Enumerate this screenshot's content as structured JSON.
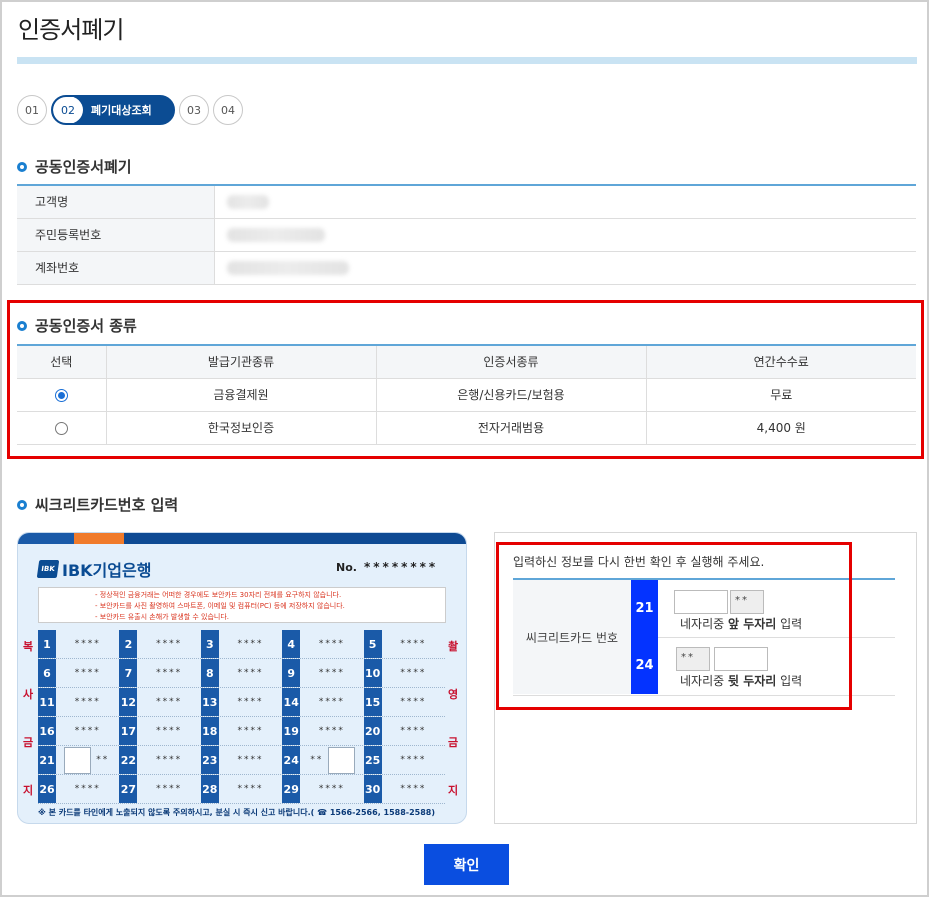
{
  "page_title": "인증서폐기",
  "steps": [
    {
      "num": "01"
    },
    {
      "num": "02",
      "label": "폐기대상조회"
    },
    {
      "num": "03"
    },
    {
      "num": "04"
    }
  ],
  "section1": {
    "title": "공동인증서폐기",
    "rows": [
      {
        "label": "고객명"
      },
      {
        "label": "주민등록번호"
      },
      {
        "label": "계좌번호"
      }
    ]
  },
  "section2": {
    "title": "공동인증서 종류",
    "headers": [
      "선택",
      "발급기관종류",
      "인증서종류",
      "연간수수료"
    ],
    "rows": [
      {
        "selected": true,
        "issuer": "금융결제원",
        "type": "은행/신용카드/보험용",
        "fee": "무료"
      },
      {
        "selected": false,
        "issuer": "한국정보인증",
        "type": "전자거래범용",
        "fee": "4,400 원"
      }
    ]
  },
  "section3": {
    "title": "씨크리트카드번호 입력"
  },
  "card": {
    "bank": "IBK기업은행",
    "logo_mark": "IBK",
    "no_label": "No.",
    "no_value": "********",
    "notices": [
      "- 정상적인 금융거래는 어떠한 경우에도 보안카드 30자리 전체를 요구하지 않습니다.",
      "- 보안카드를 사진 촬영하여 스마트폰, 이메일 및 컴퓨터(PC) 등에 저장하지 않습니다.",
      "- 보안카드 유출시 손해가 발생할 수 있습니다."
    ],
    "left_chars": [
      "복",
      "사",
      "금",
      "지"
    ],
    "right_chars": [
      "촬",
      "영",
      "금",
      "지"
    ],
    "mask": "****",
    "partial_mask": "**",
    "numbers": [
      [
        "1",
        "2",
        "3",
        "4",
        "5"
      ],
      [
        "6",
        "7",
        "8",
        "9",
        "10"
      ],
      [
        "11",
        "12",
        "13",
        "14",
        "15"
      ],
      [
        "16",
        "17",
        "18",
        "19",
        "20"
      ],
      [
        "21",
        "22",
        "23",
        "24",
        "25"
      ],
      [
        "26",
        "27",
        "28",
        "29",
        "30"
      ]
    ],
    "footer": "※ 본 카드를 타인에게 노출되지 않도록 주의하시고, 분실 시 즉시 신고 바랍니다.( ☎ 1566-2566, 1588-2588)"
  },
  "input_panel": {
    "message": "입력하신 정보를 다시 한번 확인 후 실행해 주세요.",
    "label": "씨크리트카드 번호",
    "row1": {
      "num": "21",
      "mask": "**",
      "desc_prefix": "네자리중 ",
      "desc_bold": "앞 두자리",
      "desc_suffix": " 입력"
    },
    "row2": {
      "num": "24",
      "mask": "**",
      "desc_prefix": "네자리중 ",
      "desc_bold": "뒷 두자리",
      "desc_suffix": " 입력"
    }
  },
  "confirm_label": "확인",
  "colors": {
    "accent": "#0b4c93",
    "highlight": "#e50000",
    "button": "#0a4ee0"
  }
}
